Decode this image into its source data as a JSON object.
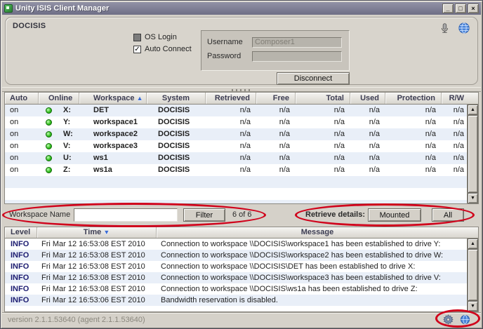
{
  "window": {
    "title": "Unity ISIS Client Manager",
    "controls": {
      "minimize": "_",
      "maximize": "□",
      "close": "×"
    }
  },
  "connection_panel": {
    "group_title": "DOCISIS",
    "os_login_label": "OS Login",
    "auto_connect_label": "Auto Connect",
    "auto_connect_check_glyph": "✓",
    "username_label": "Username",
    "username_value": "Composer1",
    "password_label": "Password",
    "password_value": "",
    "disconnect_button_label": "Disconnect"
  },
  "workspace_table": {
    "headers": {
      "auto": "Auto",
      "online": "Online",
      "workspace": "Workspace",
      "system": "System",
      "retrieved": "Retrieved",
      "free": "Free",
      "total": "Total",
      "used": "Used",
      "protection": "Protection",
      "rw": "R/W"
    },
    "sort_glyph": "▲",
    "rows": [
      {
        "auto": "on",
        "drive": "X:",
        "workspace": "DET",
        "system": "DOCISIS",
        "retrieved": "n/a",
        "free": "n/a",
        "total": "n/a",
        "used": "n/a",
        "protection": "n/a",
        "rw": "n/a"
      },
      {
        "auto": "on",
        "drive": "Y:",
        "workspace": "workspace1",
        "system": "DOCISIS",
        "retrieved": "n/a",
        "free": "n/a",
        "total": "n/a",
        "used": "n/a",
        "protection": "n/a",
        "rw": "n/a"
      },
      {
        "auto": "on",
        "drive": "W:",
        "workspace": "workspace2",
        "system": "DOCISIS",
        "retrieved": "n/a",
        "free": "n/a",
        "total": "n/a",
        "used": "n/a",
        "protection": "n/a",
        "rw": "n/a"
      },
      {
        "auto": "on",
        "drive": "V:",
        "workspace": "workspace3",
        "system": "DOCISIS",
        "retrieved": "n/a",
        "free": "n/a",
        "total": "n/a",
        "used": "n/a",
        "protection": "n/a",
        "rw": "n/a"
      },
      {
        "auto": "on",
        "drive": "U:",
        "workspace": "ws1",
        "system": "DOCISIS",
        "retrieved": "n/a",
        "free": "n/a",
        "total": "n/a",
        "used": "n/a",
        "protection": "n/a",
        "rw": "n/a"
      },
      {
        "auto": "on",
        "drive": "Z:",
        "workspace": "ws1a",
        "system": "DOCISIS",
        "retrieved": "n/a",
        "free": "n/a",
        "total": "n/a",
        "used": "n/a",
        "protection": "n/a",
        "rw": "n/a"
      }
    ]
  },
  "filter_bar": {
    "workspace_name_label": "Workspace Name",
    "filter_input_value": "",
    "filter_button_label": "Filter",
    "count_text": "6 of 6",
    "retrieve_details_label": "Retrieve details:",
    "mounted_button_label": "Mounted",
    "all_button_label": "All"
  },
  "log_table": {
    "headers": {
      "level": "Level",
      "time": "Time",
      "message": "Message"
    },
    "sort_glyph": "▼",
    "rows": [
      {
        "level": "INFO",
        "time": "Fri Mar 12 16:53:08 EST 2010",
        "message": "Connection to workspace \\\\DOCISIS\\workspace1 has been established to drive Y:"
      },
      {
        "level": "INFO",
        "time": "Fri Mar 12 16:53:08 EST 2010",
        "message": "Connection to workspace \\\\DOCISIS\\workspace2 has been established to drive W:"
      },
      {
        "level": "INFO",
        "time": "Fri Mar 12 16:53:08 EST 2010",
        "message": "Connection to workspace \\\\DOCISIS\\DET has been established to drive X:"
      },
      {
        "level": "INFO",
        "time": "Fri Mar 12 16:53:08 EST 2010",
        "message": "Connection to workspace \\\\DOCISIS\\workspace3 has been established to drive V:"
      },
      {
        "level": "INFO",
        "time": "Fri Mar 12 16:53:08 EST 2010",
        "message": "Connection to workspace \\\\DOCISIS\\ws1a has been established to drive Z:"
      },
      {
        "level": "INFO",
        "time": "Fri Mar 12 16:53:06 EST 2010",
        "message": "Bandwidth reservation is disabled."
      }
    ]
  },
  "status_bar": {
    "version_text": "version 2.1.1.53640 (agent 2.1.1.53640)"
  },
  "scrollbar": {
    "up_glyph": "▲",
    "down_glyph": "▼"
  },
  "colors": {
    "annotation_red": "#d0021b",
    "online_green": "#35c020",
    "titlebar": "#7d7d94"
  }
}
